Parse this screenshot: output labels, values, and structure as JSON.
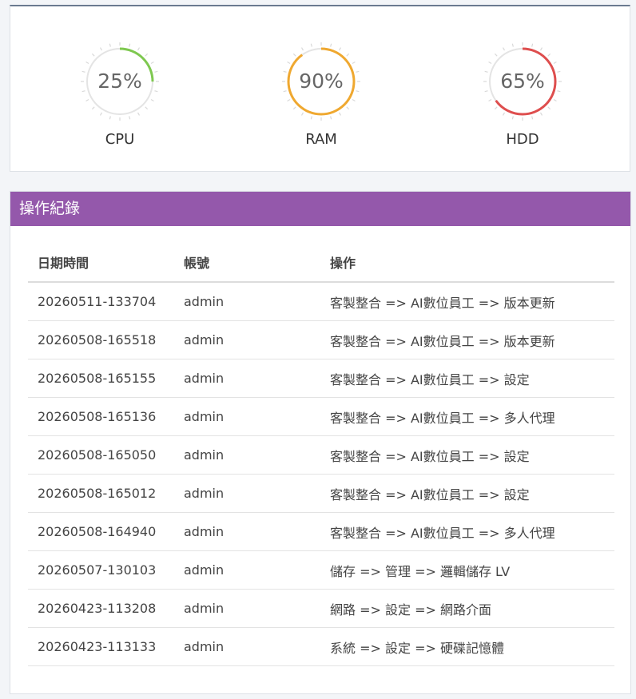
{
  "gauges": [
    {
      "label": "CPU",
      "value_text": "25%",
      "percent": 25,
      "color": "#7ec850"
    },
    {
      "label": "RAM",
      "value_text": "90%",
      "percent": 90,
      "color": "#efa830"
    },
    {
      "label": "HDD",
      "value_text": "65%",
      "percent": 65,
      "color": "#de4e4e"
    }
  ],
  "log": {
    "title": "操作紀錄",
    "headers": [
      "日期時間",
      "帳號",
      "操作"
    ],
    "rows": [
      [
        "20260511-133704",
        "admin",
        "客製整合 => AI數位員工 => 版本更新"
      ],
      [
        "20260508-165518",
        "admin",
        "客製整合 => AI數位員工 => 版本更新"
      ],
      [
        "20260508-165155",
        "admin",
        "客製整合 => AI數位員工 => 設定"
      ],
      [
        "20260508-165136",
        "admin",
        "客製整合 => AI數位員工 => 多人代理"
      ],
      [
        "20260508-165050",
        "admin",
        "客製整合 => AI數位員工 => 設定"
      ],
      [
        "20260508-165012",
        "admin",
        "客製整合 => AI數位員工 => 設定"
      ],
      [
        "20260508-164940",
        "admin",
        "客製整合 => AI數位員工 => 多人代理"
      ],
      [
        "20260507-130103",
        "admin",
        "儲存 => 管理 => 邏輯儲存 LV"
      ],
      [
        "20260423-113208",
        "admin",
        "網路 => 設定 => 網路介面"
      ],
      [
        "20260423-113133",
        "admin",
        "系統 => 設定 => 硬碟記憶體"
      ]
    ]
  }
}
